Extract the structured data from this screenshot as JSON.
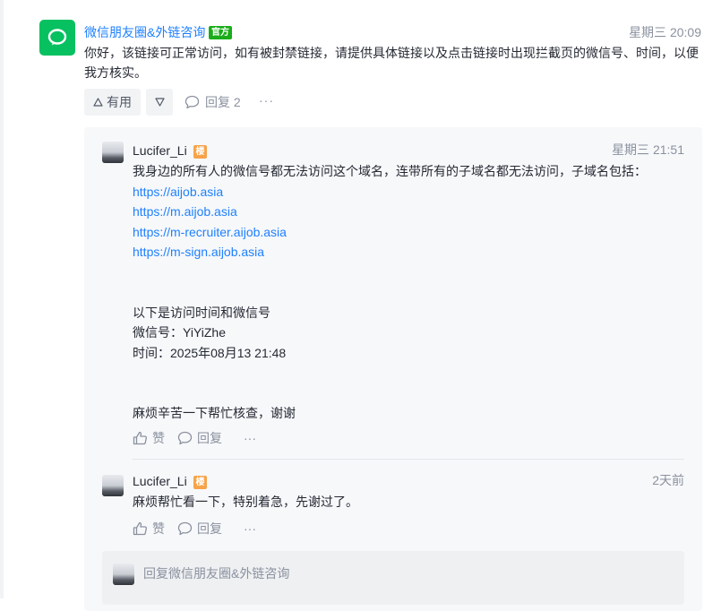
{
  "main_comment": {
    "author": "微信朋友圈&外链咨询",
    "badge": "官方",
    "time": "星期三 20:09",
    "text": "你好，该链接可正常访问，如有被封禁链接，请提供具体链接以及点击链接时出现拦截页的微信号、时间，以便我方核实。",
    "like_label": "有用",
    "reply_label": "回复 2",
    "more": "···"
  },
  "replies": [
    {
      "author": "Lucifer_Li",
      "badge": "楼",
      "time": "星期三 21:51",
      "lines": [
        {
          "text": "我身边的所有人的微信号都无法访问这个域名，连带所有的子域名都无法访问，子域名包括：",
          "link": false
        },
        {
          "text": "https://aijob.asia",
          "link": true
        },
        {
          "text": "https://m.aijob.asia",
          "link": true
        },
        {
          "text": "https://m-recruiter.aijob.asia",
          "link": true
        },
        {
          "text": "https://m-sign.aijob.asia",
          "link": true
        },
        {
          "text": "",
          "link": false
        },
        {
          "text": "",
          "link": false
        },
        {
          "text": "以下是访问时间和微信号",
          "link": false
        },
        {
          "text": "微信号：YiYiZhe",
          "link": false
        },
        {
          "text": "时间：2025年08月13 21:48",
          "link": false
        },
        {
          "text": "",
          "link": false
        },
        {
          "text": "",
          "link": false
        },
        {
          "text": "麻烦辛苦一下帮忙核查，谢谢",
          "link": false
        }
      ],
      "like_label": "赞",
      "reply_label": "回复",
      "more": "···"
    },
    {
      "author": "Lucifer_Li",
      "badge": "楼",
      "time": "2天前",
      "lines": [
        {
          "text": "麻烦帮忙看一下，特别着急，先谢过了。",
          "link": false
        }
      ],
      "like_label": "赞",
      "reply_label": "回复",
      "more": "···"
    }
  ],
  "reply_box": {
    "placeholder": "回复微信朋友圈&外链咨询"
  },
  "colors": {
    "accent": "#1e80ff",
    "official_badge": "#1aad19",
    "lz_badge": "#f7a34a",
    "avatar_green": "#07c160"
  }
}
